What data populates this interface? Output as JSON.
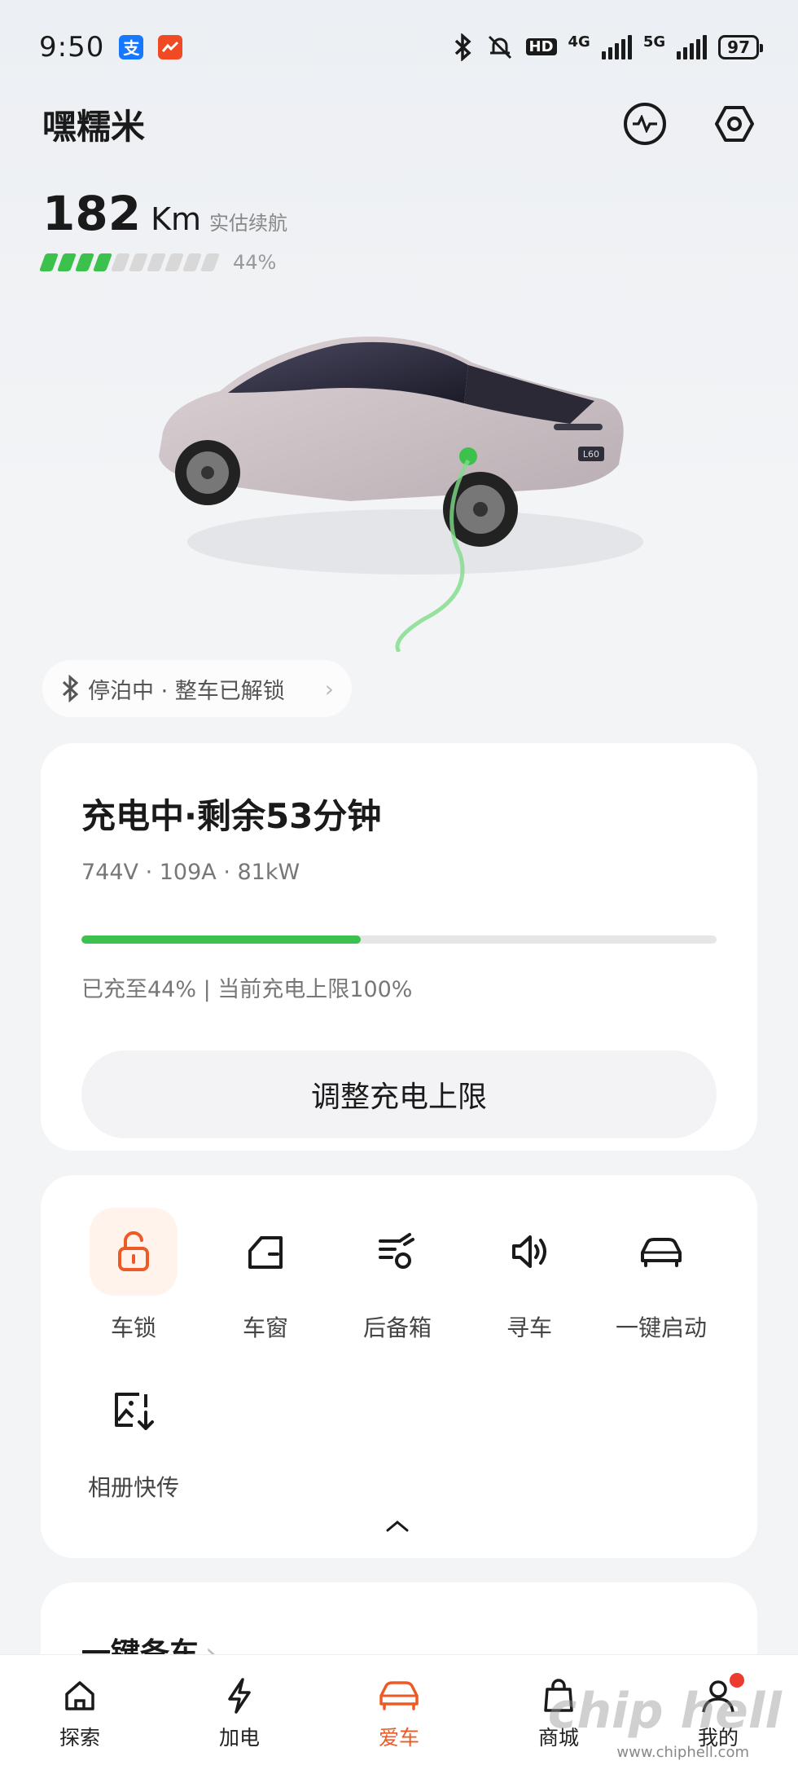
{
  "status_bar": {
    "time": "9:50",
    "network_4g": "4G",
    "network_5g": "5G",
    "hd_label": "HD",
    "battery": "97"
  },
  "header": {
    "car_name": "嘿糯米"
  },
  "range": {
    "value": "182",
    "unit": "Km",
    "label": "实估续航",
    "percent": "44%",
    "segments_on": 4,
    "segments_total": 10
  },
  "car_badge": "L60",
  "park_status": "停泊中 · 整车已解锁",
  "charging": {
    "title": "充电中·剩余53分钟",
    "stats": "744V · 109A · 81kW",
    "progress": 0.44,
    "info": "已充至44% | 当前充电上限100%",
    "adjust_button": "调整充电上限"
  },
  "controls": [
    {
      "label": "车锁",
      "icon": "unlock-icon",
      "active": true
    },
    {
      "label": "车窗",
      "icon": "window-icon",
      "active": false
    },
    {
      "label": "后备箱",
      "icon": "trunk-icon",
      "active": false
    },
    {
      "label": "寻车",
      "icon": "speaker-icon",
      "active": false
    },
    {
      "label": "一键启动",
      "icon": "car-start-icon",
      "active": false
    },
    {
      "label": "相册快传",
      "icon": "photo-transfer-icon",
      "active": false
    }
  ],
  "prep": {
    "title": "一键备车"
  },
  "tabs": [
    {
      "label": "探索",
      "icon": "home-icon"
    },
    {
      "label": "加电",
      "icon": "bolt-icon"
    },
    {
      "label": "爱车",
      "icon": "car-icon",
      "active": true
    },
    {
      "label": "商城",
      "icon": "bag-icon"
    },
    {
      "label": "我的",
      "icon": "user-icon"
    }
  ],
  "watermark": "chip hell",
  "watermark_url": "www.chiphell.com",
  "colors": {
    "accent": "#ee5a25",
    "progress": "#3cc14d",
    "alert_dot": "#ee3b30"
  }
}
